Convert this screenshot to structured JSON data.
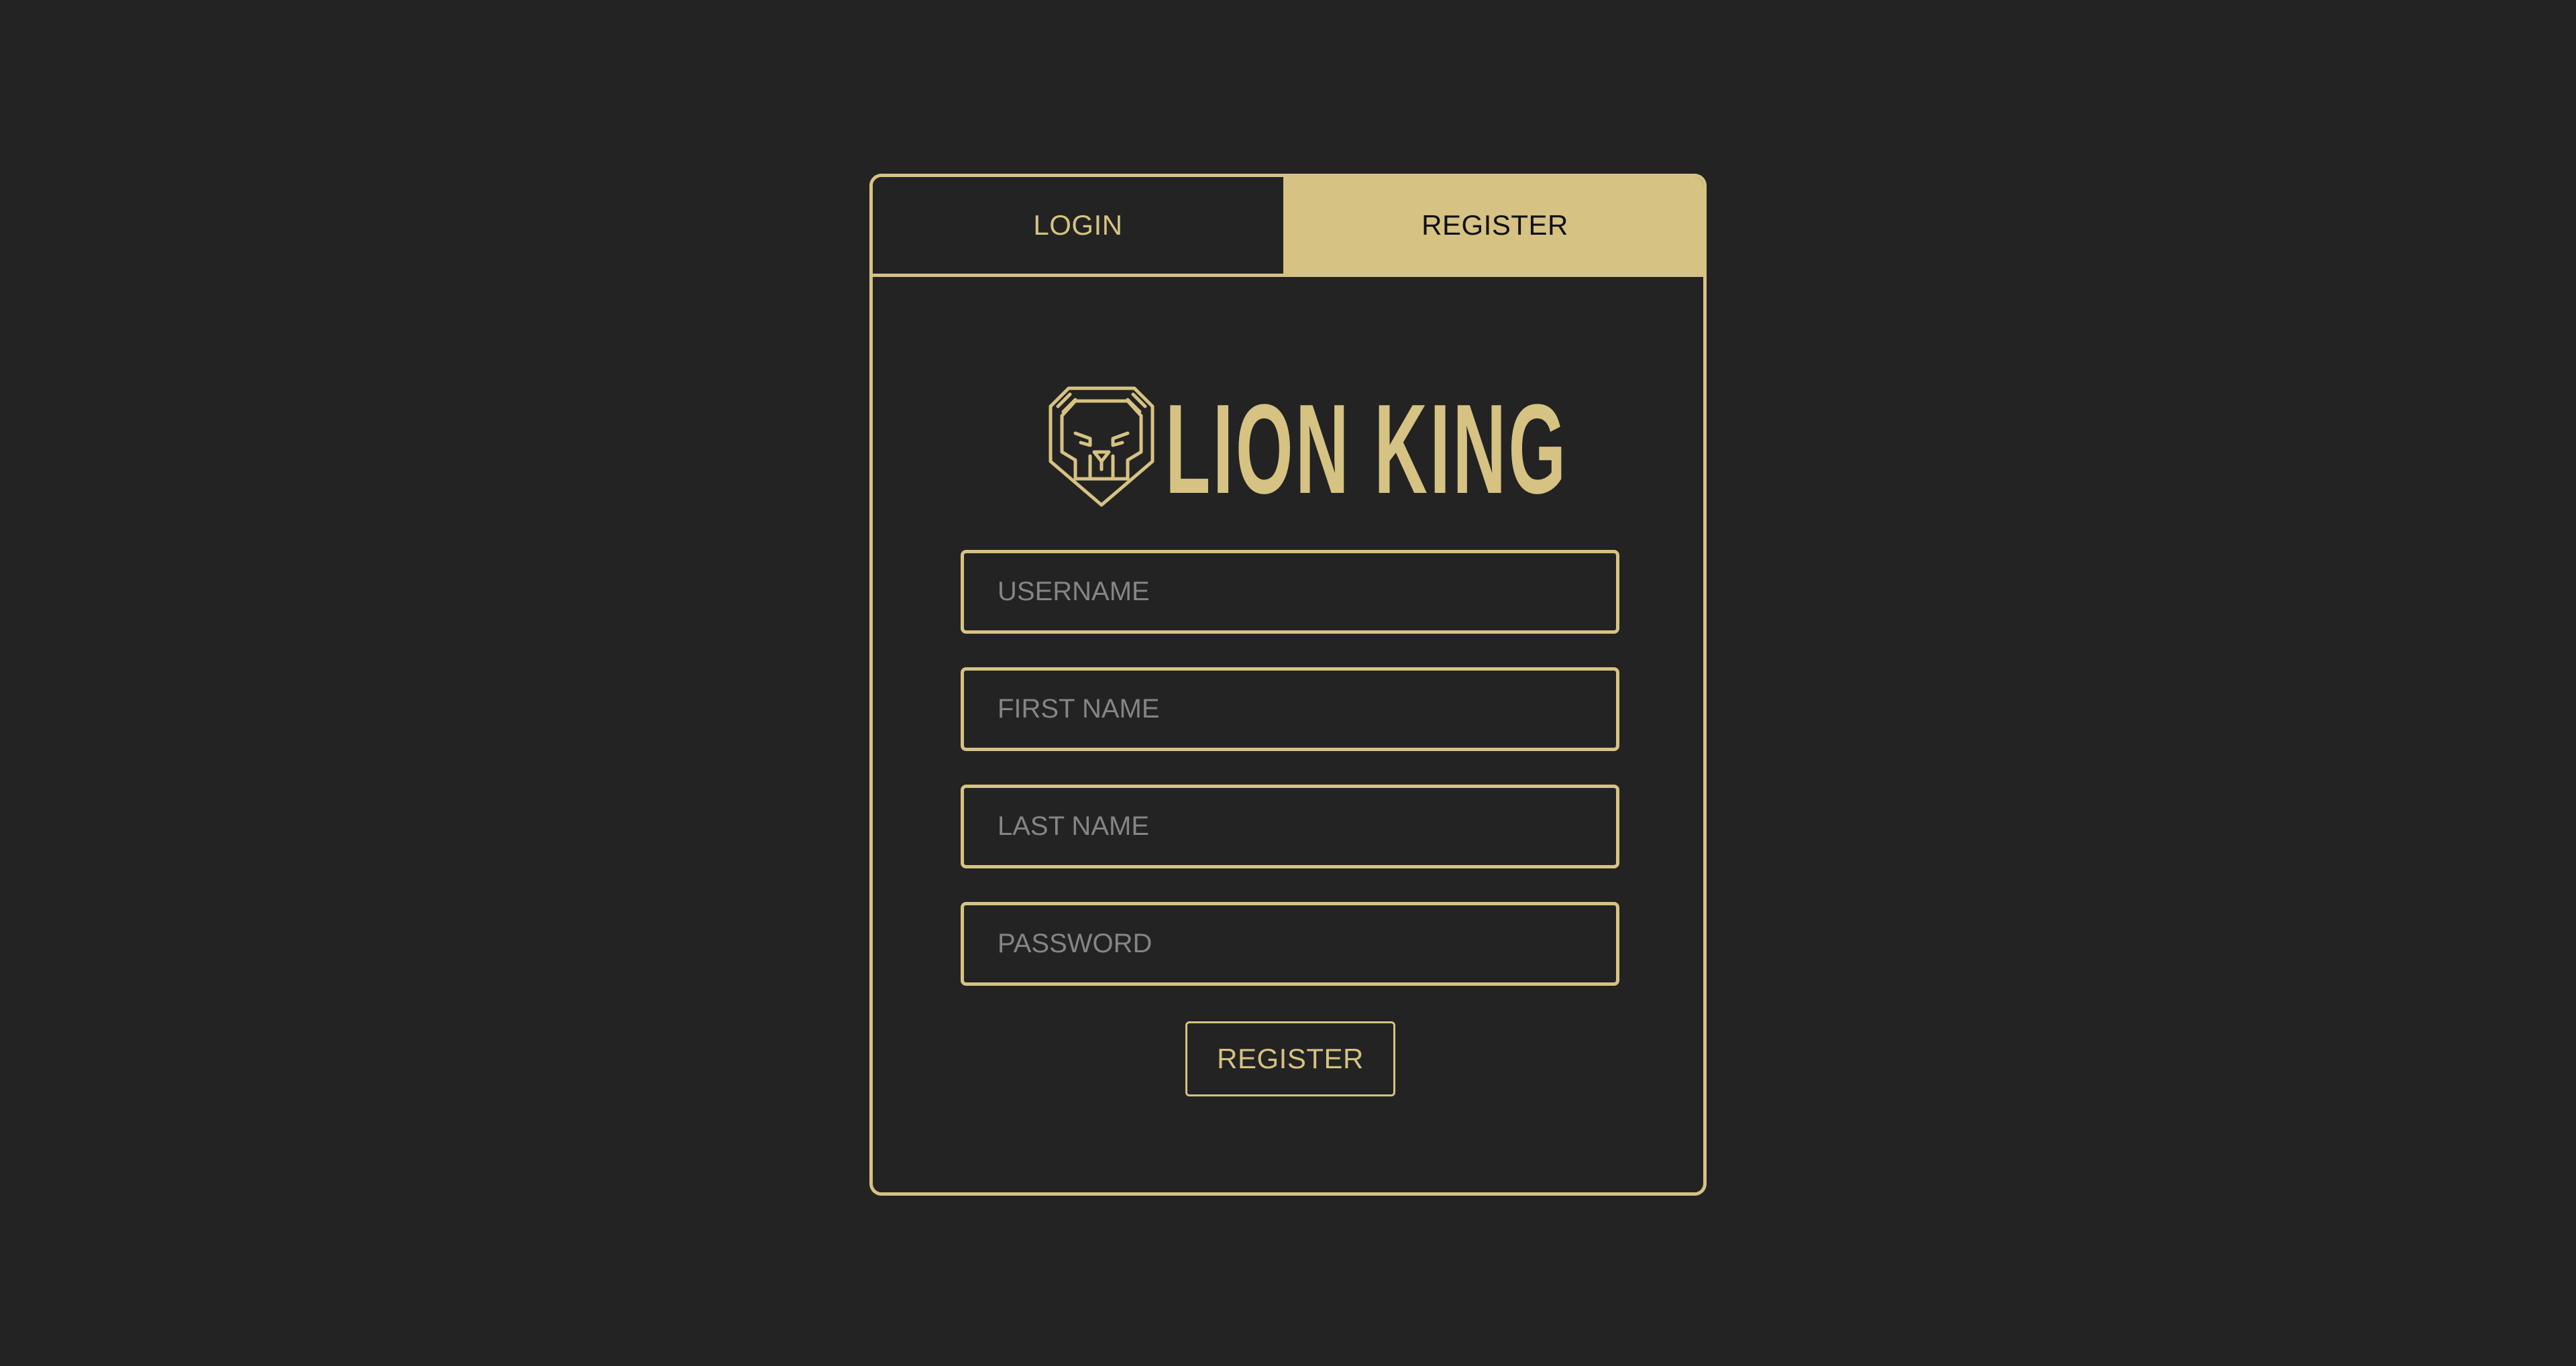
{
  "tabs": {
    "login_label": "LOGIN",
    "register_label": "REGISTER",
    "active": "register"
  },
  "brand": {
    "name": "LION KING",
    "icon": "lion-head-icon"
  },
  "form": {
    "username": {
      "value": "",
      "placeholder": "USERNAME"
    },
    "first_name": {
      "value": "",
      "placeholder": "FIRST NAME"
    },
    "last_name": {
      "value": "",
      "placeholder": "LAST NAME"
    },
    "password": {
      "value": "",
      "placeholder": "PASSWORD"
    },
    "submit_label": "REGISTER"
  },
  "colors": {
    "background": "#232323",
    "accent": "#d6c383",
    "placeholder": "#858585",
    "active_tab_text": "#111111"
  }
}
